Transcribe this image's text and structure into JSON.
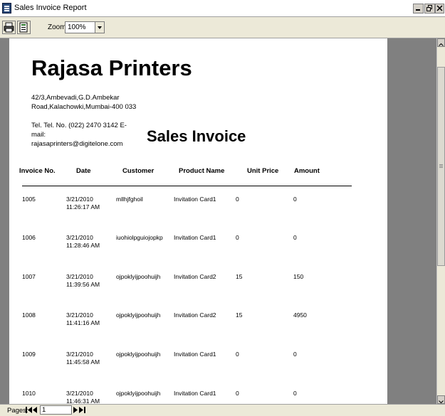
{
  "window": {
    "title": "Sales Invoice Report"
  },
  "toolbar": {
    "zoom_label": "Zoom",
    "zoom_value": "100%"
  },
  "report": {
    "company": "Rajasa Printers",
    "address_line1": "42/3,Ambevadi,G.D.Ambekar",
    "address_line2": "Road,Kalachowki,Mumbai-400 033",
    "contact_line1": "Tel. Tel. No. (022) 2470 3142 E-mail:",
    "contact_line2": "rajasaprinters@digitelone.com",
    "title": "Sales Invoice",
    "columns": [
      "Invoice No.",
      "Date",
      "Customer",
      "Product Name",
      "Unit Price",
      "Amount"
    ],
    "rows": [
      {
        "invoice": "1005",
        "date1": "3/21/2010",
        "date2": "11:26:17 AM",
        "customer": "mllhjfghoil",
        "product": "Invitation Card1",
        "price": "0",
        "amount": "0"
      },
      {
        "invoice": "1006",
        "date1": "3/21/2010",
        "date2": "11:28:46 AM",
        "customer": "iuohiolpguiojopkp",
        "product": "Invitation Card1",
        "price": "0",
        "amount": "0"
      },
      {
        "invoice": "1007",
        "date1": "3/21/2010",
        "date2": "11:39:56 AM",
        "customer": "ojpoklyijpoohuijh",
        "product": "Invitation Card2",
        "price": "15",
        "amount": "150"
      },
      {
        "invoice": "1008",
        "date1": "3/21/2010",
        "date2": "11:41:16 AM",
        "customer": "ojpoklyijpoohuijh",
        "product": "Invitation Card2",
        "price": "15",
        "amount": "4950"
      },
      {
        "invoice": "1009",
        "date1": "3/21/2010",
        "date2": "11:45:58 AM",
        "customer": "ojpoklyijpoohuijh",
        "product": "Invitation Card1",
        "price": "0",
        "amount": "0"
      },
      {
        "invoice": "1010",
        "date1": "3/21/2010",
        "date2": "11:46:31 AM",
        "customer": "ojpoklyijpoohuijh",
        "product": "Invitation Card1",
        "price": "0",
        "amount": "0"
      }
    ]
  },
  "statusbar": {
    "pages_label": "Pages:",
    "current_page": "1"
  },
  "icons": {
    "app": "report-icon",
    "print": "printer-icon",
    "export": "export-icon",
    "first": "first-page-icon",
    "prev": "prev-page-icon",
    "next": "next-page-icon",
    "last": "last-page-icon"
  }
}
